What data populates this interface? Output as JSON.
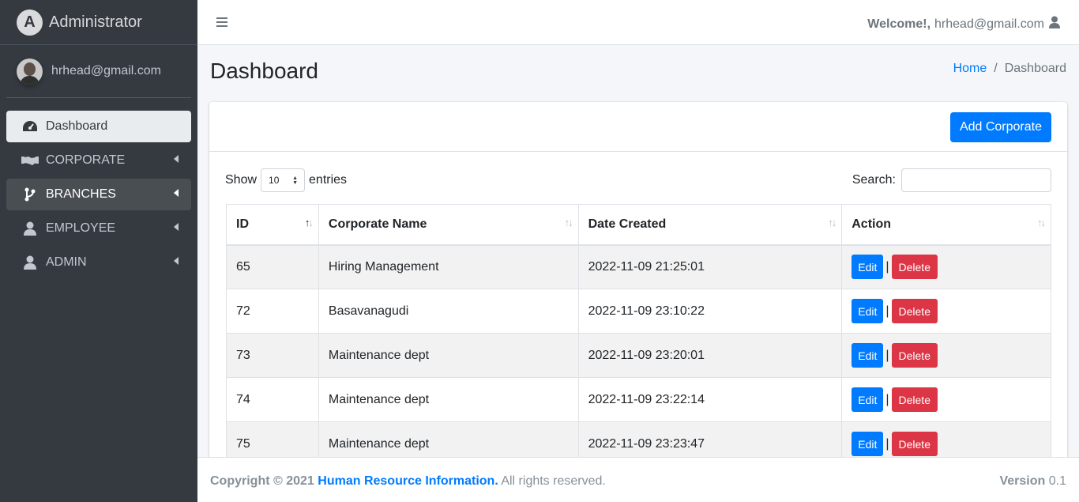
{
  "brand": {
    "title": "Administrator",
    "logo_letter": "A"
  },
  "user": {
    "email": "hrhead@gmail.com"
  },
  "sidebar": {
    "items": [
      {
        "label": "Dashboard",
        "icon": "tachometer-icon"
      },
      {
        "label": "CORPORATE",
        "icon": "handshake-icon"
      },
      {
        "label": "BRANCHES",
        "icon": "code-branch-icon"
      },
      {
        "label": "EMPLOYEE",
        "icon": "user-icon"
      },
      {
        "label": "ADMIN",
        "icon": "user-icon"
      }
    ]
  },
  "topbar": {
    "welcome": "Welcome!,",
    "email": "hrhead@gmail.com"
  },
  "page": {
    "title": "Dashboard"
  },
  "breadcrumb": {
    "home": "Home",
    "sep": "/",
    "current": "Dashboard"
  },
  "card": {
    "add_button": "Add Corporate",
    "show_label": "Show",
    "entries_value": "10",
    "entries_label": "entries",
    "search_label": "Search:",
    "search_value": ""
  },
  "table": {
    "columns": [
      "ID",
      "Corporate Name",
      "Date Created",
      "Action"
    ],
    "rows": [
      {
        "id": "65",
        "name": "Hiring Management",
        "date": "2022-11-09 21:25:01"
      },
      {
        "id": "72",
        "name": "Basavanagudi",
        "date": "2022-11-09 23:10:22"
      },
      {
        "id": "73",
        "name": "Maintenance dept",
        "date": "2022-11-09 23:20:01"
      },
      {
        "id": "74",
        "name": "Maintenance dept",
        "date": "2022-11-09 23:22:14"
      },
      {
        "id": "75",
        "name": "Maintenance dept",
        "date": "2022-11-09 23:23:47"
      }
    ],
    "edit_label": "Edit",
    "delete_label": "Delete",
    "separator": "|"
  },
  "footer": {
    "copyright": "Copyright © 2021",
    "brand": "Human Resource Information.",
    "rights": "All rights reserved.",
    "version_label": "Version",
    "version_value": "0.1"
  },
  "colors": {
    "primary": "#007bff",
    "danger": "#dc3545",
    "sidebar": "#343a40"
  }
}
